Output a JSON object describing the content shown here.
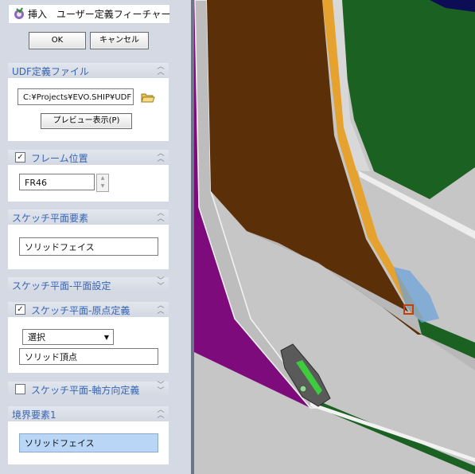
{
  "window": {
    "title": "挿入　ユーザー定義フィーチャー"
  },
  "buttons": {
    "ok": "OK",
    "cancel": "キャンセル"
  },
  "udf": {
    "header": "UDF定義ファイル",
    "path": "C:¥Projects¥EVO.SHIP¥UDF",
    "preview": "プレビュー表示(P)"
  },
  "frame": {
    "header": "フレーム位置",
    "checked": true,
    "value": "FR46"
  },
  "sketch_plane_element": {
    "header": "スケッチ平面要素",
    "value": "ソリッドフェイス"
  },
  "sketch_plane_setting": {
    "header": "スケッチ平面-平面設定"
  },
  "sketch_origin": {
    "header": "スケッチ平面-原点定義",
    "checked": true,
    "select": "選択",
    "value": "ソリッド頂点"
  },
  "sketch_axis": {
    "header": "スケッチ平面-軸方向定義",
    "checked": false
  },
  "boundary": {
    "header": "境界要素1",
    "value": "ソリッドフェイス"
  },
  "colors": {
    "brown": "#5b2f08",
    "green": "#1b6121",
    "purple": "#7d0b7c",
    "orange": "#e5a22e",
    "section_text": "#3565b5",
    "highlight": "#b9d6f6"
  }
}
